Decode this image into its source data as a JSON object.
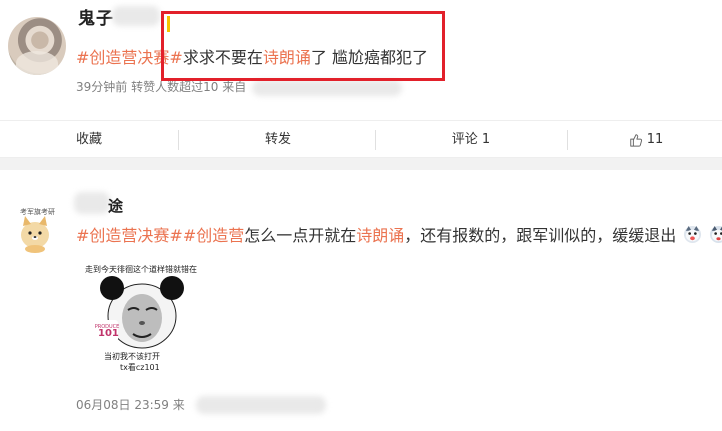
{
  "post1": {
    "username": "鬼子",
    "content_prefix": "#创造营决赛#",
    "content_mid": "求求不要在",
    "content_highlight": "诗朗诵",
    "content_suffix": "了 尴尬癌都犯了",
    "time": "39分钟前",
    "meta_text": "转赞人数超过10",
    "meta_tail": "来自"
  },
  "actions": {
    "collect": "收藏",
    "repost": "转发",
    "comment": "评论 1",
    "like_count": "11"
  },
  "post2": {
    "username": "途",
    "avatar_caption": "考军旗考研",
    "topic1": "#创造营决赛#",
    "topic2": "#创造营",
    "content_mid": "怎么一点开就在",
    "content_highlight": "诗朗诵",
    "content_suffix": "，还有报数的，跟军训似的，缓缓退出",
    "meme_caption_top": "走到今天徘徊这个道样错就错在",
    "meme_logo": "101",
    "meme_caption_bottom1": "当初我不该打开",
    "meme_caption_bottom2": "tx看cz101",
    "time": "06月08日 23:59",
    "meta_tail": "来"
  },
  "colors": {
    "topic": "#eb7350",
    "highlight_box": "#e2202a",
    "meta": "#808080"
  }
}
